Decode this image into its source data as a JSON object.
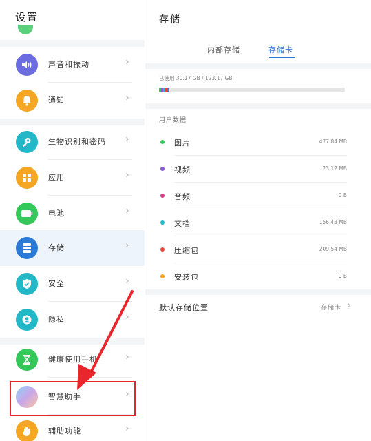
{
  "settings": {
    "title": "设置",
    "items": [
      {
        "label": "声音和振动",
        "icon": "speaker-icon",
        "color": "#6a6ce0"
      },
      {
        "label": "通知",
        "icon": "bell-icon",
        "color": "#f5a623"
      },
      {
        "label": "生物识别和密码",
        "icon": "key-icon",
        "color": "#22b8c8"
      },
      {
        "label": "应用",
        "icon": "apps-grid-icon",
        "color": "#f5a623"
      },
      {
        "label": "电池",
        "icon": "battery-icon",
        "color": "#34c759"
      },
      {
        "label": "存储",
        "icon": "storage-icon",
        "color": "#2b7bd6"
      },
      {
        "label": "安全",
        "icon": "shield-icon",
        "color": "#22b8c8"
      },
      {
        "label": "隐私",
        "icon": "privacy-icon",
        "color": "#22b8c8"
      },
      {
        "label": "健康使用手机",
        "icon": "hourglass-icon",
        "color": "#34c759"
      },
      {
        "label": "智慧助手",
        "icon": "smart-assistant-icon",
        "color": "#c9a7ea"
      },
      {
        "label": "辅助功能",
        "icon": "hand-icon",
        "color": "#f5a623"
      }
    ],
    "chevron": "›"
  },
  "storage": {
    "title": "存储",
    "tabs": [
      "内部存储",
      "存储卡"
    ],
    "active_tab": "存储卡",
    "used_text": "已使用 30.17 GB / 123.17 GB",
    "section_title": "用户数据",
    "rows": [
      {
        "name": "图片",
        "size": "477.84 MB",
        "color": "#34c759"
      },
      {
        "name": "视频",
        "size": "23.12 MB",
        "color": "#8a5cd1"
      },
      {
        "name": "音频",
        "size": "0 B",
        "color": "#d63c8a"
      },
      {
        "name": "文档",
        "size": "156.43 MB",
        "color": "#22b8c8"
      },
      {
        "name": "压缩包",
        "size": "209.54 MB",
        "color": "#e8463a"
      },
      {
        "name": "安装包",
        "size": "0 B",
        "color": "#f5a623"
      }
    ],
    "default_location": {
      "label": "默认存储位置",
      "value": "存储卡",
      "chevron": "›"
    }
  },
  "annotation": {
    "color": "#e8262b"
  }
}
